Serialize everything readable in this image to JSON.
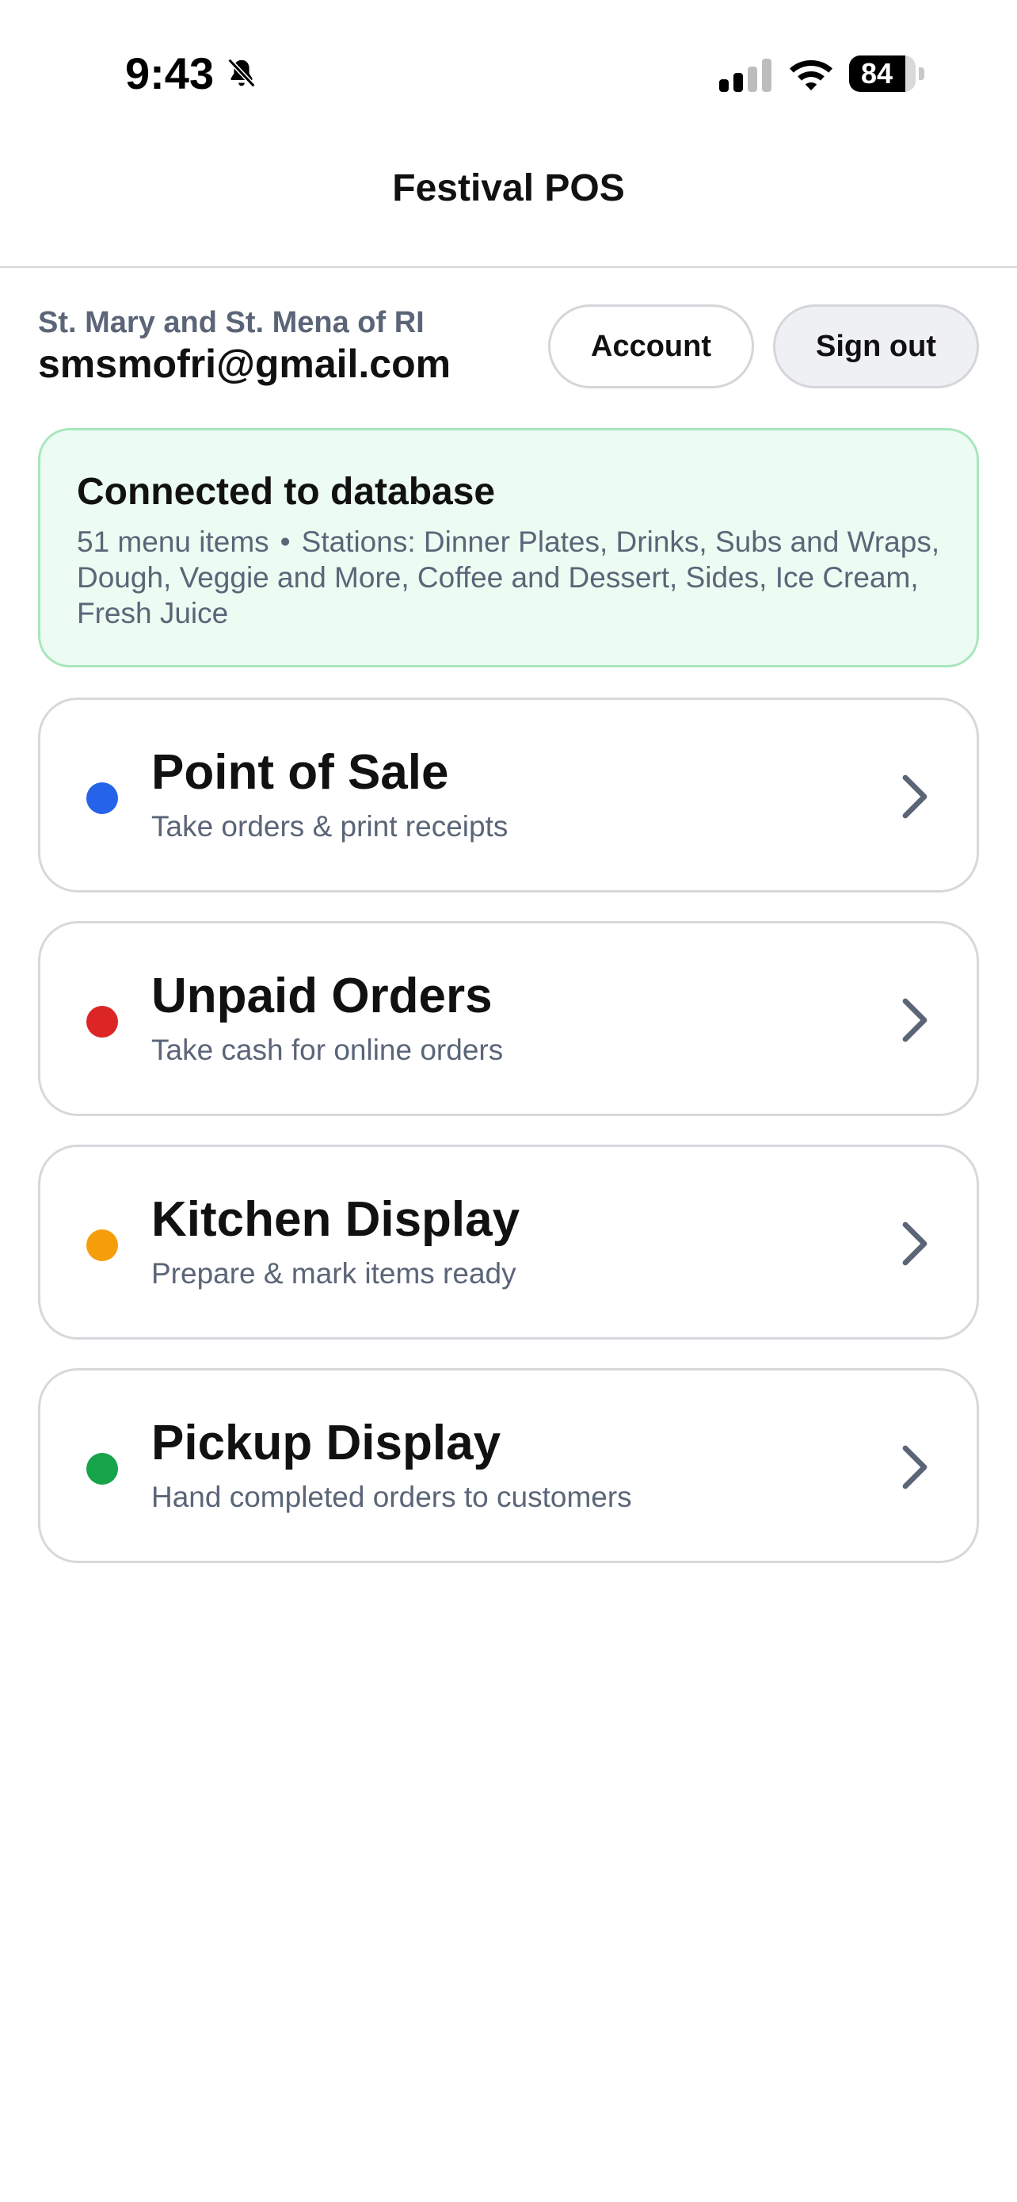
{
  "status_bar": {
    "time": "9:43",
    "battery_level": "84",
    "battery_fraction": 0.84,
    "icons": [
      "bell-slash-icon",
      "cellular-signal-icon",
      "wifi-icon",
      "battery-icon"
    ]
  },
  "header": {
    "title": "Festival POS"
  },
  "account": {
    "org_name": "St. Mary and St. Mena of RI",
    "email": "smsmofri@gmail.com",
    "account_label": "Account",
    "signout_label": "Sign out"
  },
  "database": {
    "title": "Connected to database",
    "items_count": "51 menu items",
    "separator": "•",
    "stations": "Stations: Dinner Plates, Drinks, Subs and Wraps, Dough, Veggie and More, Coffee and Dessert, Sides, Ice Cream, Fresh Juice",
    "colors": {
      "background": "#ecfcf2",
      "border": "#a8e6bd"
    }
  },
  "cards": [
    {
      "title": "Point of Sale",
      "subtitle": "Take orders & print receipts",
      "dot_color": "#2563eb",
      "icon": "chevron-right-icon"
    },
    {
      "title": "Unpaid Orders",
      "subtitle": "Take cash for online orders",
      "dot_color": "#dc2626",
      "icon": "chevron-right-icon"
    },
    {
      "title": "Kitchen Display",
      "subtitle": "Prepare & mark items ready",
      "dot_color": "#f59e0b",
      "icon": "chevron-right-icon"
    },
    {
      "title": "Pickup Display",
      "subtitle": "Hand completed orders to customers",
      "dot_color": "#16a34a",
      "icon": "chevron-right-icon"
    }
  ]
}
